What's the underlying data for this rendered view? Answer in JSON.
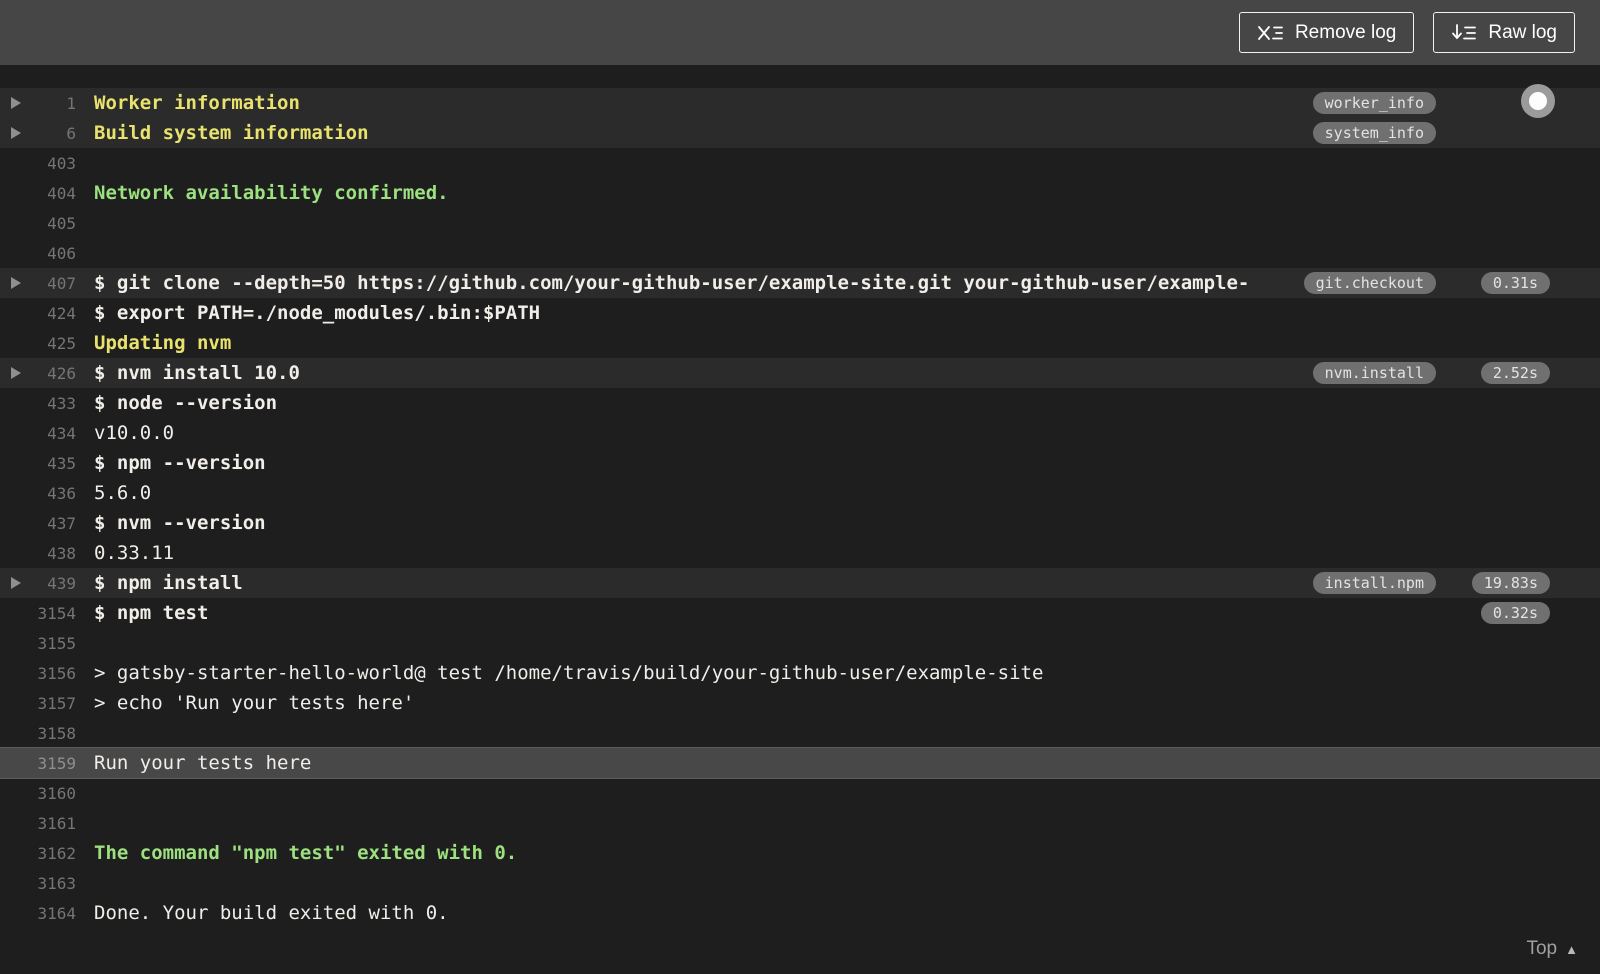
{
  "toolbar": {
    "remove_log_label": "Remove log",
    "raw_log_label": "Raw log"
  },
  "log": {
    "top_link_label": "Top",
    "rows": [
      {
        "num": "1",
        "text": "Worker information",
        "style": "yellow",
        "fold": true,
        "badge": "worker_info"
      },
      {
        "num": "6",
        "text": "Build system information",
        "style": "yellow",
        "fold": true,
        "badge": "system_info"
      },
      {
        "num": "403",
        "text": ""
      },
      {
        "num": "404",
        "text": "Network availability confirmed.",
        "style": "green"
      },
      {
        "num": "405",
        "text": ""
      },
      {
        "num": "406",
        "text": ""
      },
      {
        "num": "407",
        "text": "$ git clone --depth=50 https://github.com/your-github-user/example-site.git your-github-user/example-",
        "style": "command",
        "fold": true,
        "badge": "git.checkout",
        "duration": "0.31s"
      },
      {
        "num": "424",
        "text": "$ export PATH=./node_modules/.bin:$PATH",
        "style": "command"
      },
      {
        "num": "425",
        "text": "Updating nvm",
        "style": "yellow"
      },
      {
        "num": "426",
        "text": "$ nvm install 10.0",
        "style": "command",
        "fold": true,
        "badge": "nvm.install",
        "duration": "2.52s"
      },
      {
        "num": "433",
        "text": "$ node --version",
        "style": "command"
      },
      {
        "num": "434",
        "text": "v10.0.0"
      },
      {
        "num": "435",
        "text": "$ npm --version",
        "style": "command"
      },
      {
        "num": "436",
        "text": "5.6.0"
      },
      {
        "num": "437",
        "text": "$ nvm --version",
        "style": "command"
      },
      {
        "num": "438",
        "text": "0.33.11"
      },
      {
        "num": "439",
        "text": "$ npm install",
        "style": "command",
        "fold": true,
        "badge": "install.npm",
        "duration": "19.83s"
      },
      {
        "num": "3154",
        "text": "$ npm test",
        "style": "command",
        "duration": "0.32s"
      },
      {
        "num": "3155",
        "text": ""
      },
      {
        "num": "3156",
        "text": "> gatsby-starter-hello-world@ test /home/travis/build/your-github-user/example-site"
      },
      {
        "num": "3157",
        "text": "> echo 'Run your tests here'"
      },
      {
        "num": "3158",
        "text": ""
      },
      {
        "num": "3159",
        "text": "Run your tests here",
        "highlighted": true
      },
      {
        "num": "3160",
        "text": ""
      },
      {
        "num": "3161",
        "text": ""
      },
      {
        "num": "3162",
        "text": "The command \"npm test\" exited with 0.",
        "style": "green"
      },
      {
        "num": "3163",
        "text": ""
      },
      {
        "num": "3164",
        "text": "Done. Your build exited with 0."
      }
    ]
  },
  "colors": {
    "toolbar_bg": "#464646",
    "log_bg": "#1e1e1e",
    "fold_row_bg": "#2b2b2b",
    "highlight_row_bg": "#484848",
    "yellow_text": "#e9e36e",
    "green_text": "#9de07f",
    "plain_text": "#f1eee9",
    "line_number": "#757575",
    "badge_bg": "#707070"
  }
}
